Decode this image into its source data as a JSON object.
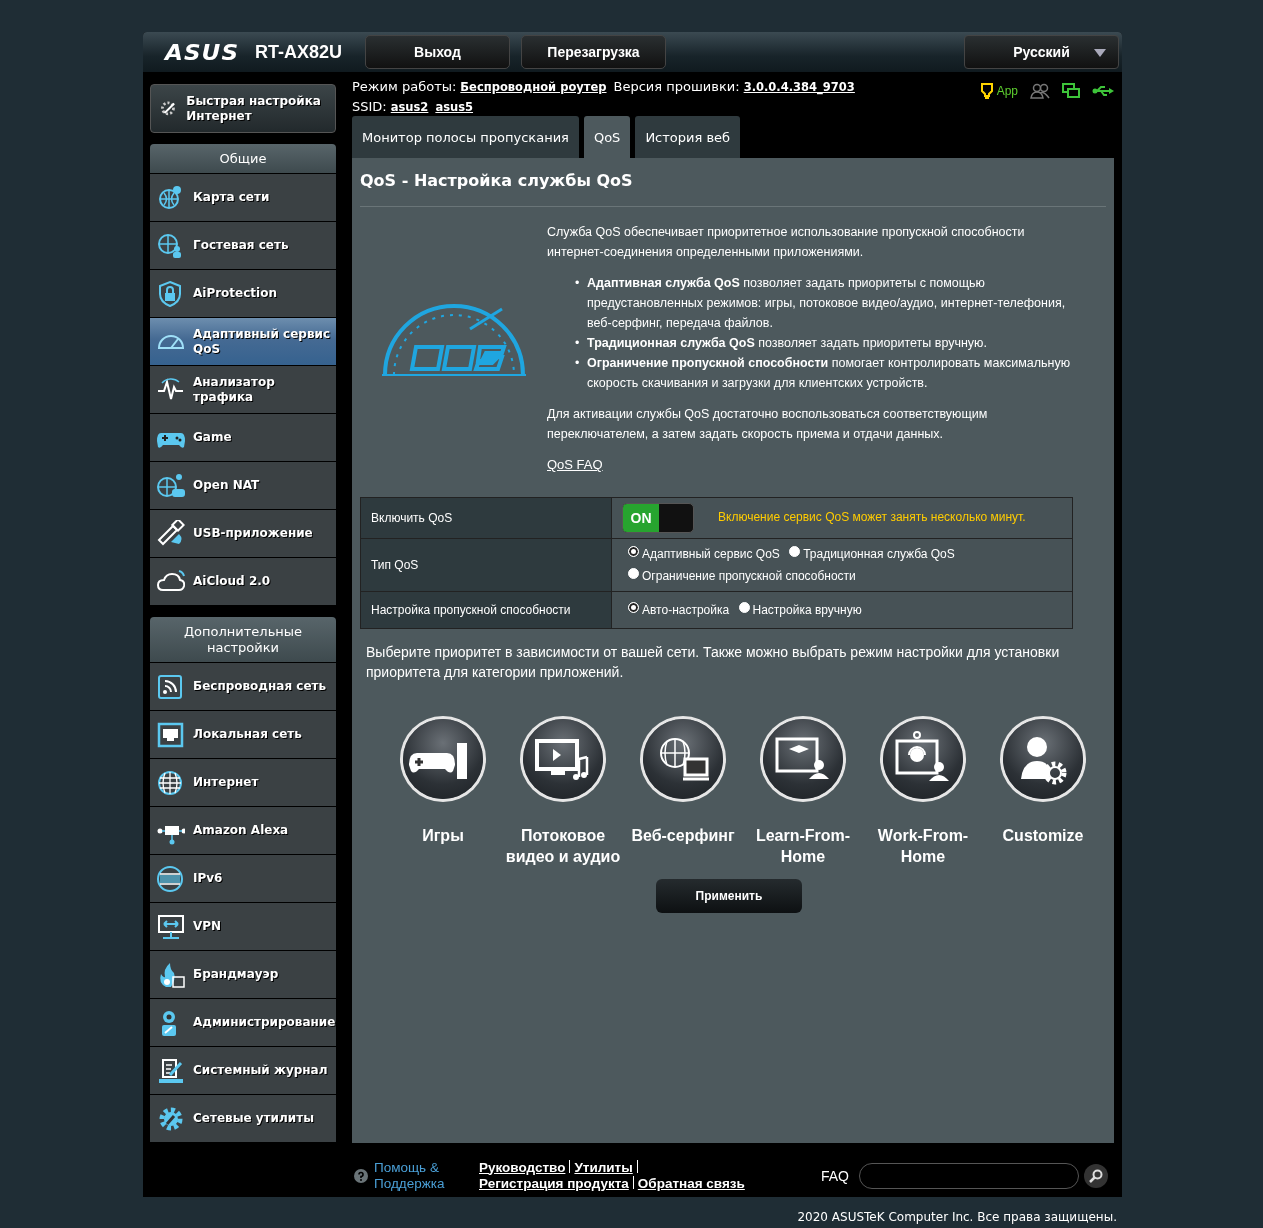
{
  "header": {
    "logo": "ASUS",
    "model": "RT-AX82U",
    "buttons": [
      "Выход",
      "Перезагрузка"
    ],
    "language": "Русский"
  },
  "info": {
    "mode_label": "Режим работы:",
    "mode": "Беспроводной роутер",
    "firmware_label": "Версия прошивки:",
    "firmware": "3.0.0.4.384_9703",
    "ssid_label": "SSID:",
    "ssids": [
      "asus2",
      "asus5"
    ],
    "app_label": "App"
  },
  "quick_setup": "Быстрая настройка Интернет",
  "sidebar": {
    "groups": [
      {
        "title": "Общие",
        "items": [
          {
            "label": "Карта сети",
            "selected": false
          },
          {
            "label": "Гостевая сеть",
            "selected": false
          },
          {
            "label": "AiProtection",
            "selected": false
          },
          {
            "label": "Адаптивный сервис QoS",
            "selected": true
          },
          {
            "label": "Анализатор трафика",
            "selected": false
          },
          {
            "label": "Game",
            "selected": false
          },
          {
            "label": "Open NAT",
            "selected": false
          },
          {
            "label": "USB-приложение",
            "selected": false
          },
          {
            "label": "AiCloud 2.0",
            "selected": false
          }
        ]
      },
      {
        "title": "Дополнительные настройки",
        "items": [
          {
            "label": "Беспроводная сеть",
            "selected": false
          },
          {
            "label": "Локальная сеть",
            "selected": false
          },
          {
            "label": "Интернет",
            "selected": false
          },
          {
            "label": "Amazon Alexa",
            "selected": false
          },
          {
            "label": "IPv6",
            "selected": false
          },
          {
            "label": "VPN",
            "selected": false
          },
          {
            "label": "Брандмауэр",
            "selected": false
          },
          {
            "label": "Администрирование",
            "selected": false
          },
          {
            "label": "Системный журнал",
            "selected": false
          },
          {
            "label": "Сетевые утилиты",
            "selected": false
          }
        ]
      }
    ]
  },
  "tabs": [
    {
      "label": "Монитор полосы пропускания",
      "selected": false
    },
    {
      "label": "QoS",
      "selected": true
    },
    {
      "label": "История веб",
      "selected": false
    }
  ],
  "panel": {
    "title": "QoS - Настройка службы QoS",
    "intro": "Служба QoS обеспечивает приоритетное использование пропускной способности интернет-соединения определенными приложениями.",
    "bullets": [
      {
        "marker": "•",
        "text": "**Адаптивная служба QoS** позволяет задать приоритеты с помощью предустановленных режимов: игры, потоковое видео/аудио, интернет-телефония, веб-серфинг, передача файлов."
      },
      {
        "marker": "•",
        "text": "**Традиционная служба QoS** позволяет задать приоритеты вручную."
      },
      {
        "marker": "•",
        "text": "**Ограничение пропускной способности** помогает контролировать максимальную скорость скачивания и загрузки для клиентских устройств."
      }
    ],
    "activation": "Для активации службы QoS достаточно воспользоваться соответствующим переключателем, а затем задать скорость приема и отдачи данных.",
    "faq_link": "QoS FAQ",
    "settings": [
      {
        "kind": "toggle",
        "label": "Включить QoS",
        "on": true,
        "on_text": "ON",
        "note": "Включение сервис QoS может занять несколько минут."
      },
      {
        "kind": "radio",
        "label": "Тип QoS",
        "options": [
          {
            "label": "Адаптивный сервис QoS",
            "selected": true
          },
          {
            "label": "Традиционная служба QoS",
            "selected": false
          },
          {
            "label": "Ограничение пропускной способности",
            "selected": false
          }
        ]
      },
      {
        "kind": "radio",
        "label": "Настройка пропускной способности",
        "options": [
          {
            "label": "Авто-настройка",
            "selected": true
          },
          {
            "label": "Настройка вручную",
            "selected": false
          }
        ]
      }
    ],
    "priority_hint": "Выберите приоритет в зависимости от вашей сети. Также можно выбрать режим настройки для установки приоритета для категории приложений.",
    "priorities": [
      {
        "label": "Игры"
      },
      {
        "label": "Потоковое видео и аудио"
      },
      {
        "label": "Веб-серфинг"
      },
      {
        "label": "Learn-From-Home"
      },
      {
        "label": "Work-From-Home"
      },
      {
        "label": "Customize"
      }
    ],
    "apply": "Применить"
  },
  "footer": {
    "help": "Помощь & Поддержка",
    "links": [
      "Руководство",
      "Утилиты",
      "Регистрация продукта",
      "Обратная связь"
    ],
    "faq_label": "FAQ",
    "copyright": "2020 ASUSTeK Computer Inc. Все права защищены."
  }
}
